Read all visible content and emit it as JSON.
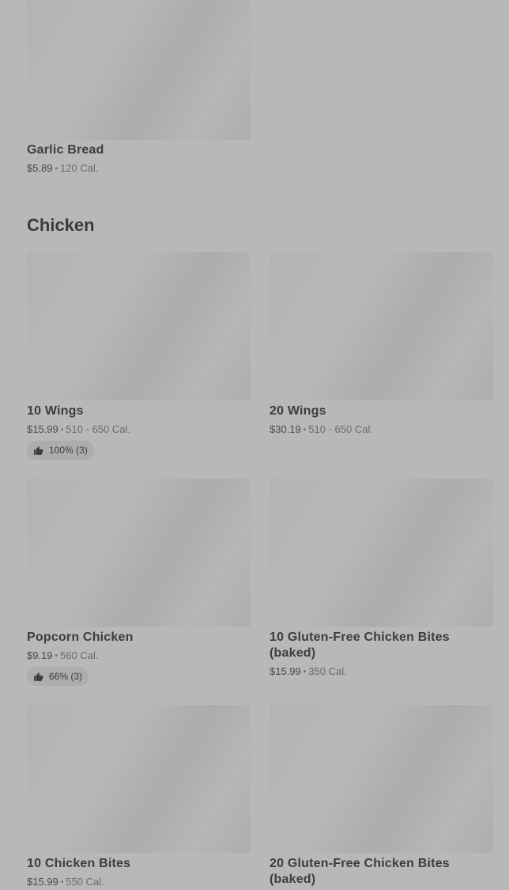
{
  "top_item": {
    "name": "Garlic Bread",
    "price": "$5.89",
    "calories": "120 Cal."
  },
  "section": {
    "title": "Chicken"
  },
  "items": [
    {
      "name": "10 Wings",
      "price": "$15.99",
      "calories": "510 - 650 Cal.",
      "rating": "100% (3)"
    },
    {
      "name": "20 Wings",
      "price": "$30.19",
      "calories": "510 - 650 Cal."
    },
    {
      "name": "Popcorn Chicken",
      "price": "$9.19",
      "calories": "560 Cal.",
      "rating": "66% (3)"
    },
    {
      "name": "10 Gluten-Free Chicken Bites (baked)",
      "price": "$15.99",
      "calories": "350 Cal."
    },
    {
      "name": "10 Chicken Bites",
      "price": "$15.99",
      "calories": "550 Cal."
    },
    {
      "name": "20 Gluten-Free Chicken Bites (baked)",
      "price": "",
      "calories": ""
    }
  ],
  "icons": {
    "rating": "thumbs-up-icon"
  }
}
